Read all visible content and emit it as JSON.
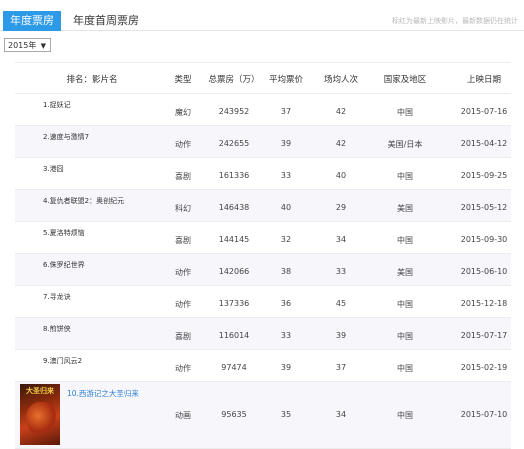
{
  "tabs": [
    {
      "label": "年度票房",
      "active": true
    },
    {
      "label": "年度首周票房",
      "active": false
    }
  ],
  "hint": "标红为最新上映影片，最新数据仍在统计",
  "year_select": {
    "value": "2015年"
  },
  "columns": [
    "排名：影片名",
    "类型",
    "总票房（万）",
    "平均票价",
    "场均人次",
    "国家及地区",
    "上映日期"
  ],
  "rows": [
    {
      "name": "1.捉妖记",
      "type": "魔幻",
      "box": "243952",
      "price": "37",
      "per_show": "42",
      "region": "中国",
      "date": "2015-07-16"
    },
    {
      "name": "2.速度与激情7",
      "type": "动作",
      "box": "242655",
      "price": "39",
      "per_show": "42",
      "region": "美国/日本",
      "date": "2015-04-12"
    },
    {
      "name": "3.港囧",
      "type": "喜剧",
      "box": "161336",
      "price": "33",
      "per_show": "40",
      "region": "中国",
      "date": "2015-09-25"
    },
    {
      "name": "4.复仇者联盟2：奥创纪元",
      "type": "科幻",
      "box": "146438",
      "price": "40",
      "per_show": "29",
      "region": "美国",
      "date": "2015-05-12"
    },
    {
      "name": "5.夏洛特烦恼",
      "type": "喜剧",
      "box": "144145",
      "price": "32",
      "per_show": "34",
      "region": "中国",
      "date": "2015-09-30"
    },
    {
      "name": "6.侏罗纪世界",
      "type": "动作",
      "box": "142066",
      "price": "38",
      "per_show": "33",
      "region": "美国",
      "date": "2015-06-10"
    },
    {
      "name": "7.寻龙诀",
      "type": "动作",
      "box": "137336",
      "price": "36",
      "per_show": "45",
      "region": "中国",
      "date": "2015-12-18"
    },
    {
      "name": "8.煎饼侠",
      "type": "喜剧",
      "box": "116014",
      "price": "33",
      "per_show": "39",
      "region": "中国",
      "date": "2015-07-17"
    },
    {
      "name": "9.澳门风云2",
      "type": "动作",
      "box": "97474",
      "price": "39",
      "per_show": "37",
      "region": "中国",
      "date": "2015-02-19"
    },
    {
      "name": "10.西游记之大圣归来",
      "type": "动画",
      "box": "95635",
      "price": "35",
      "per_show": "34",
      "region": "中国",
      "date": "2015-07-10"
    }
  ],
  "poster_title": "大圣归来"
}
